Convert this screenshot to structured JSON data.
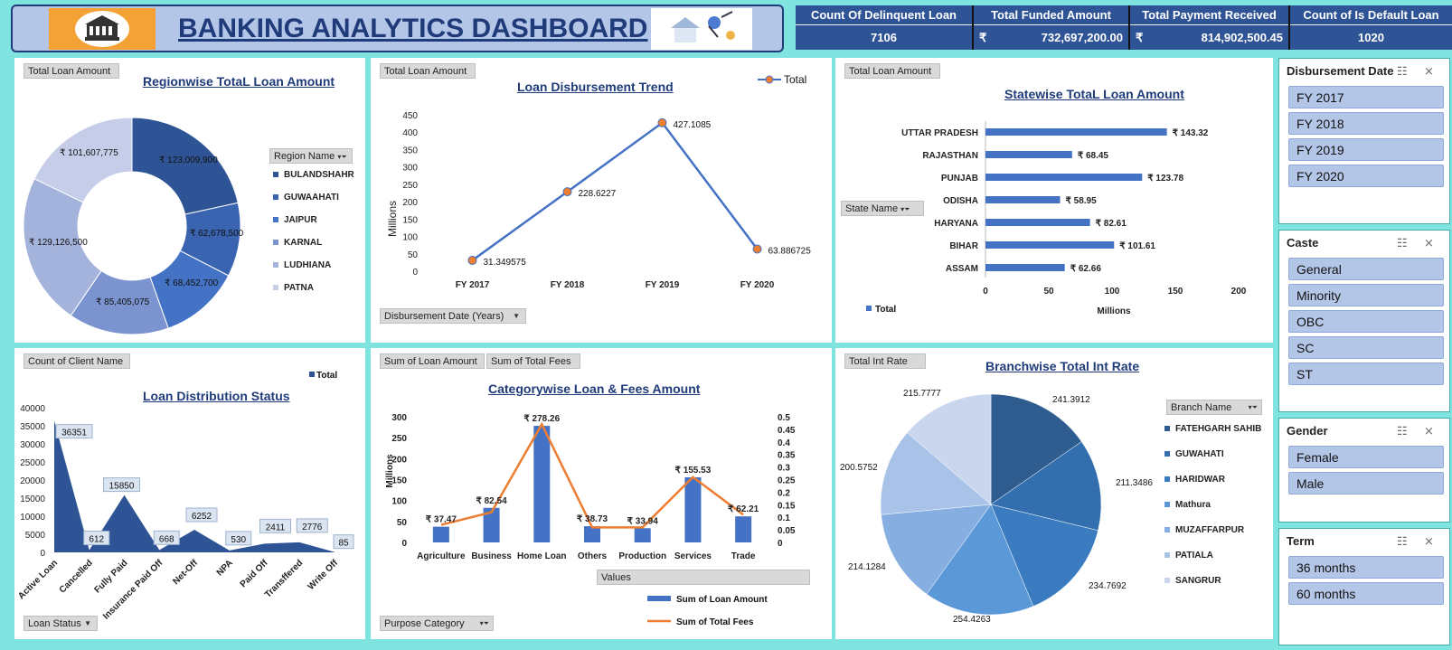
{
  "header": {
    "title": "BANKING ANALYTICS DASHBOARD",
    "kpis": [
      {
        "label": "Count Of Delinquent Loan",
        "value": "7106",
        "currency": ""
      },
      {
        "label": "Total Funded Amount",
        "value": "732,697,200.00",
        "currency": "₹"
      },
      {
        "label": "Total Payment Received",
        "value": "814,902,500.45",
        "currency": "₹"
      },
      {
        "label": "Count of Is Default Loan",
        "value": "1020",
        "currency": ""
      }
    ]
  },
  "region_chart": {
    "field_button": "Total Loan Amount",
    "title": "Regionwise TotaL Loan Amount",
    "filter_label": "Region Name",
    "chart_data": {
      "type": "pie",
      "categories": [
        "BULANDSHAHR",
        "GUWAAHATI",
        "JAIPUR",
        "KARNAL",
        "LUDHIANA",
        "PATNA"
      ],
      "values": [
        123009900,
        62678500,
        68452700,
        85405075,
        129126500,
        101607775
      ],
      "data_labels": [
        "₹ 123,009,900",
        "₹ 62,678,500",
        "₹ 68,452,700",
        "₹ 85,405,075",
        "₹ 129,126,500",
        "₹ 101,607,775"
      ],
      "colors": [
        "#2f5496",
        "#3a63b0",
        "#4472c4",
        "#7b93cf",
        "#a4b3dc",
        "#c5cde8"
      ]
    }
  },
  "trend_chart": {
    "field_button": "Total Loan Amount",
    "title": "Loan Disbursement Trend",
    "legend": "Total",
    "ylabel": "Millions",
    "bottom_button": "Disbursement Date (Years)",
    "chart_data": {
      "type": "line",
      "categories": [
        "FY 2017",
        "FY 2018",
        "FY 2019",
        "FY 2020"
      ],
      "values": [
        31.349575,
        228.6227,
        427.1085,
        63.886725
      ],
      "data_labels": [
        "31.349575",
        "228.6227",
        "427.1085",
        "63.886725"
      ],
      "ylim": [
        0,
        450
      ],
      "yticks": [
        "0",
        "50",
        "100",
        "150",
        "200",
        "250",
        "300",
        "350",
        "400",
        "450"
      ]
    }
  },
  "state_chart": {
    "field_button": "Total Loan Amount",
    "title": "Statewise TotaL Loan Amount",
    "filter_label": "State Name",
    "legend": "Total",
    "xlabel": "Millions",
    "chart_data": {
      "type": "bar",
      "categories": [
        "UTTAR PRADESH",
        "RAJASTHAN",
        "PUNJAB",
        "ODISHA",
        "HARYANA",
        "BIHAR",
        "ASSAM"
      ],
      "values": [
        143.32,
        68.45,
        123.78,
        58.95,
        82.61,
        101.61,
        62.66
      ],
      "data_labels": [
        "₹ 143.32",
        "₹ 68.45",
        "₹ 123.78",
        "₹ 58.95",
        "₹ 82.61",
        "₹ 101.61",
        "₹ 62.66"
      ],
      "xlim": [
        0,
        200
      ],
      "xticks": [
        "0",
        "50",
        "100",
        "150",
        "200"
      ]
    }
  },
  "status_chart": {
    "field_button": "Count of Client Name",
    "title": "Loan Distribution Status",
    "legend": "Total",
    "bottom_button": "Loan Status",
    "chart_data": {
      "type": "area",
      "categories": [
        "Active Loan",
        "Cancelled",
        "Fully Paid",
        "Insurance Paid Off",
        "Net-Off",
        "NPA",
        "Paid Off",
        "Transffered",
        "Write Off"
      ],
      "values": [
        36351,
        612,
        15850,
        668,
        6252,
        530,
        2411,
        2776,
        85
      ],
      "data_labels": [
        "36351",
        "612",
        "15850",
        "668",
        "6252",
        "530",
        "2411",
        "2776",
        "85"
      ],
      "ylim": [
        0,
        40000
      ],
      "yticks": [
        "0",
        "5000",
        "10000",
        "15000",
        "20000",
        "25000",
        "30000",
        "35000",
        "40000"
      ]
    }
  },
  "category_chart": {
    "field_buttons": [
      "Sum of Loan Amount",
      "Sum of Total Fees"
    ],
    "title": "Categorywise Loan & Fees Amount",
    "ylabel": "Millions",
    "values_button": "Values",
    "bottom_button": "Purpose Category",
    "legend": [
      "Sum of Loan Amount",
      "Sum of Total Fees"
    ],
    "chart_data": {
      "type": "bar",
      "categories": [
        "Agriculture",
        "Business",
        "Home Loan",
        "Others",
        "Production",
        "Services",
        "Trade"
      ],
      "series": [
        {
          "name": "Sum of Loan Amount",
          "values": [
            37.47,
            82.54,
            278.26,
            38.73,
            33.94,
            155.53,
            62.21
          ]
        },
        {
          "name": "Sum of Total Fees",
          "values": [
            0.07,
            0.12,
            0.47,
            0.06,
            0.06,
            0.26,
            0.11
          ]
        }
      ],
      "data_labels": [
        "₹ 37.47",
        "₹ 82.54",
        "₹ 278.26",
        "₹ 38.73",
        "₹ 33.94",
        "₹ 155.53",
        "₹ 62.21"
      ],
      "ylim": [
        0,
        300
      ],
      "y2lim": [
        0,
        0.5
      ],
      "yticks": [
        "0",
        "50",
        "100",
        "150",
        "200",
        "250",
        "300"
      ],
      "y2ticks": [
        "0",
        "0.05",
        "0.1",
        "0.15",
        "0.2",
        "0.25",
        "0.3",
        "0.35",
        "0.4",
        "0.45",
        "0.5"
      ]
    }
  },
  "branch_chart": {
    "field_button": "Total Int Rate",
    "title": "Branchwise Total Int Rate",
    "filter_label": "Branch Name",
    "chart_data": {
      "type": "pie",
      "categories": [
        "FATEHGARH SAHIB",
        "GUWAHATI",
        "HARIDWAR",
        "Mathura",
        "MUZAFFARPUR",
        "PATIALA",
        "SANGRUR"
      ],
      "values": [
        241.3912,
        211.3486,
        234.7692,
        254.4263,
        214.1284,
        200.5752,
        215.7777
      ],
      "data_labels": [
        "241.3912",
        "211.3486",
        "234.7692",
        "254.4263",
        "214.1284",
        "200.5752",
        "215.7777"
      ],
      "colors": [
        "#2e5c8f",
        "#336fae",
        "#3b7cc0",
        "#5a98d8",
        "#86aee0",
        "#a9c3e8",
        "#c9d6ee"
      ]
    }
  },
  "slicers": [
    {
      "title": "Disbursement Date",
      "items": [
        "FY 2017",
        "FY 2018",
        "FY 2019",
        "FY 2020"
      ]
    },
    {
      "title": "Caste",
      "items": [
        "General",
        "Minority",
        "OBC",
        "SC",
        "ST"
      ]
    },
    {
      "title": "Gender",
      "items": [
        "Female",
        "Male"
      ]
    },
    {
      "title": "Term",
      "items": [
        "36 months",
        "60 months"
      ]
    }
  ]
}
